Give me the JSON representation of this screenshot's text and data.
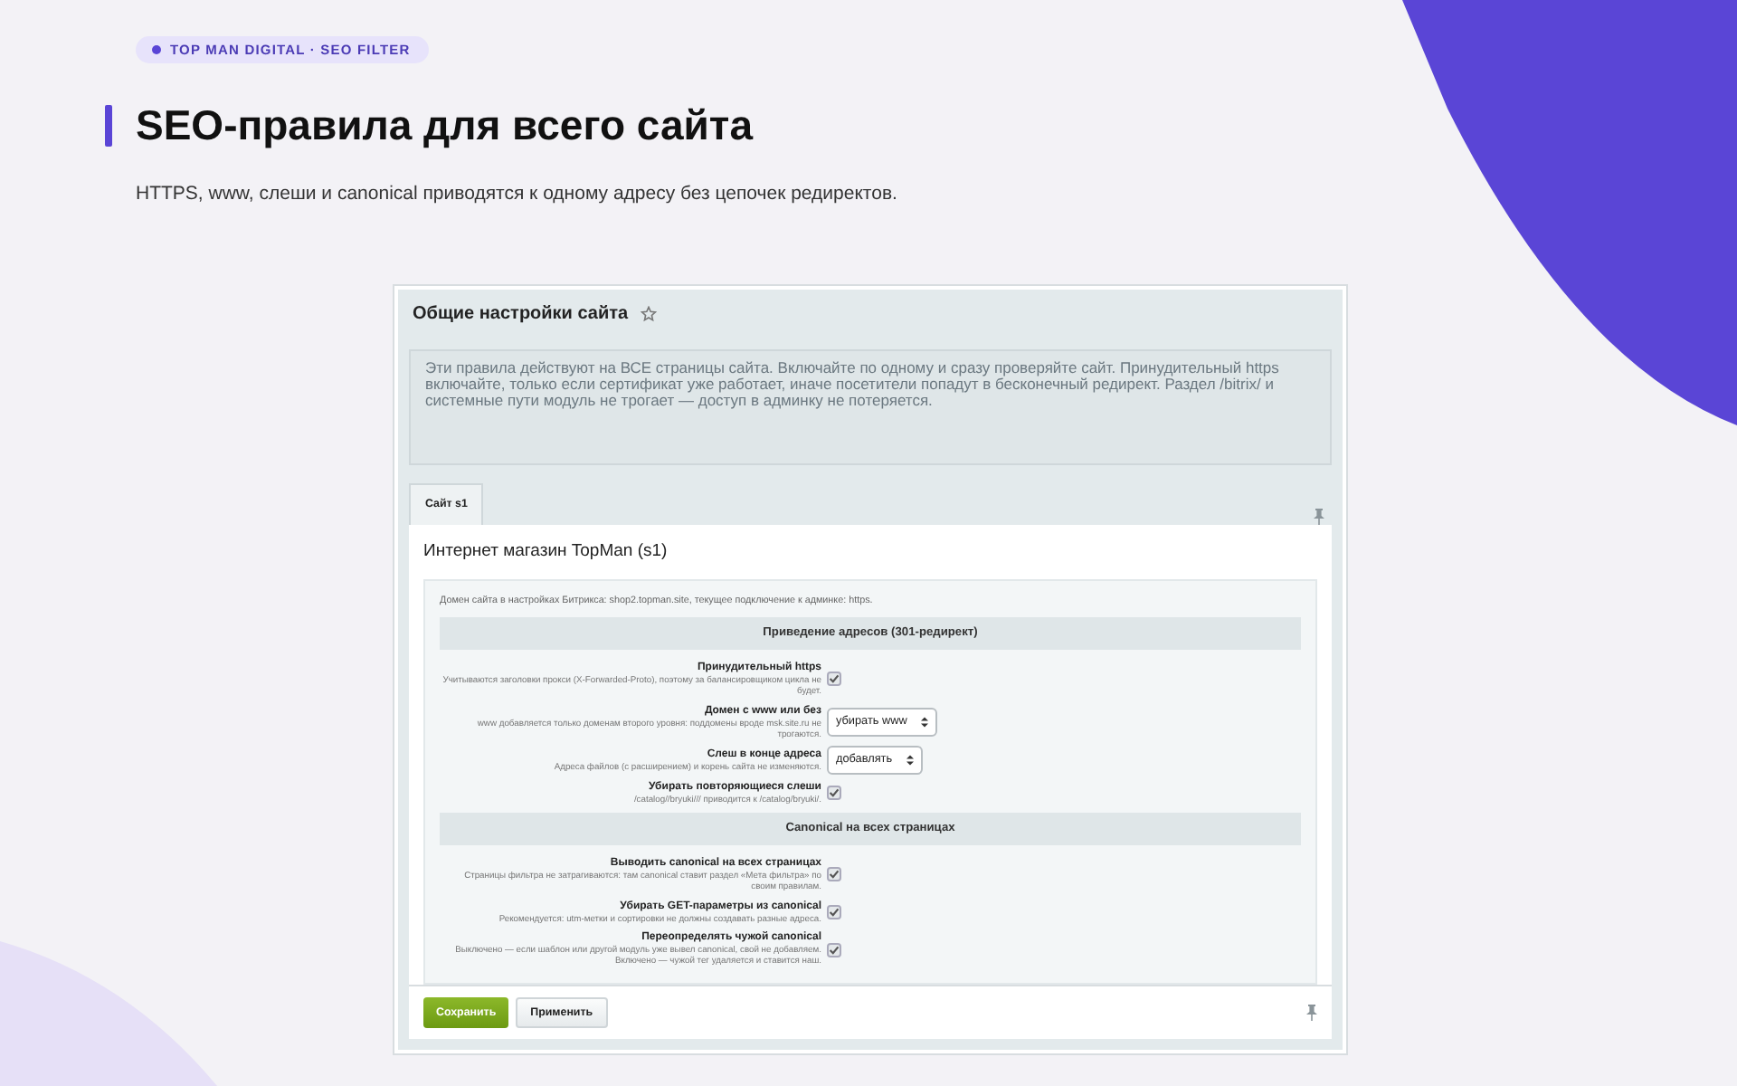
{
  "badge": "TOP MAN DIGITAL · SEO FILTER",
  "heading": "SEO-правила для всего сайта",
  "subtitle": "HTTPS, www, слеши и canonical приводятся к одному адресу без цепочек редиректов.",
  "admin": {
    "title": "Общие настройки сайта",
    "notice": "Эти правила действуют на ВСЕ страницы сайта. Включайте по одному и сразу проверяйте сайт. Принудительный https включайте, только если сертификат уже работает, иначе посетители попадут в бесконечный редирект. Раздел /bitrix/ и системные пути модуль не трогает — доступ в админку не потеряется.",
    "tabs": [
      {
        "label": "Сайт s1",
        "selected": true
      }
    ],
    "site_title": "Интернет магазин TopMan (s1)",
    "domain_note": "Домен сайта в настройках Битрикса: shop2.topman.site, текущее подключение к админке: https.",
    "sections": [
      {
        "title": "Приведение адресов (301-редирект)",
        "rows": [
          {
            "kind": "checkbox",
            "label": "Принудительный https",
            "hint": "Учитываются заголовки прокси (X-Forwarded-Proto), поэтому за балансировщиком цикла не будет.",
            "checked": true
          },
          {
            "kind": "select",
            "label": "Домен с www или без",
            "hint": "www добавляется только доменам второго уровня: поддомены вроде msk.site.ru не трогаются.",
            "value": "убирать www"
          },
          {
            "kind": "select",
            "label": "Слеш в конце адреса",
            "hint": "Адреса файлов (с расширением) и корень сайта не изменяются.",
            "value": "добавлять"
          },
          {
            "kind": "checkbox",
            "label": "Убирать повторяющиеся слеши",
            "hint": "/catalog//bryuki/// приводится к /catalog/bryuki/.",
            "checked": true
          }
        ]
      },
      {
        "title": "Canonical на всех страницах",
        "rows": [
          {
            "kind": "checkbox",
            "label": "Выводить canonical на всех страницах",
            "hint": "Страницы фильтра не затрагиваются: там canonical ставит раздел «Мета фильтра» по своим правилам.",
            "checked": true
          },
          {
            "kind": "checkbox",
            "label": "Убирать GET-параметры из canonical",
            "hint": "Рекомендуется: utm-метки и сортировки не должны создавать разные адреса.",
            "checked": true
          },
          {
            "kind": "checkbox",
            "label": "Переопределять чужой canonical",
            "hint": "Выключено — если шаблон или другой модуль уже вывел canonical, свой не добавляем. Включено — чужой тег удаляется и ставится наш.",
            "checked": true
          }
        ]
      }
    ],
    "buttons": [
      {
        "label": "Сохранить",
        "kind": "primary"
      },
      {
        "label": "Применить",
        "kind": "secondary"
      }
    ]
  }
}
